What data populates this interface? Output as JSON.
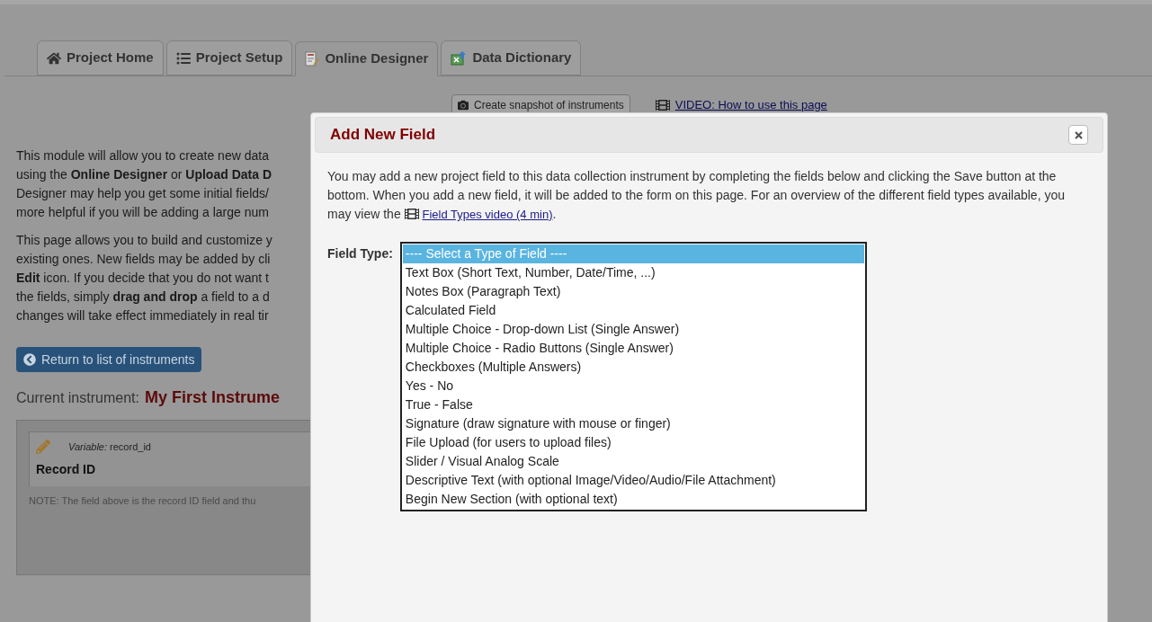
{
  "tabs": [
    {
      "label": "Project Home",
      "selected": false
    },
    {
      "label": "Project Setup",
      "selected": false
    },
    {
      "label": "Online Designer",
      "selected": true
    },
    {
      "label": "Data Dictionary",
      "selected": false
    }
  ],
  "snapshot_button": "Create snapshot of instruments",
  "video_link": "VIDEO: How to use this page",
  "intro_lines": [
    "This module will allow you to create new data",
    "using the **Online Designer** or **Upload Data D**",
    "Designer may help you get some initial fields/",
    "more helpful if you will be adding a large num"
  ],
  "help_lines": [
    "This page allows you to build and customize y",
    "existing ones. New fields may be added by cli",
    "**Edit** icon. If you decide that you do not want t",
    "the fields, simply **drag and drop** a field to a d",
    "changes will take effect immediately in real tir"
  ],
  "return_button": "Return to list of instruments",
  "current_instrument": {
    "label": "Current instrument:",
    "name": "My First Instrume"
  },
  "field_card": {
    "variable_label": "Variable:",
    "variable": "record_id",
    "label": "Record ID",
    "note": "NOTE: The field above is the record ID field and thu"
  },
  "dialog": {
    "title": "Add New Field",
    "intro": "You may add a new project field to this data collection instrument by completing the fields below and clicking the Save button at the bottom. When you add a new field, it will be added to the form on this page. For an overview of the different field types available, you may view the",
    "intro_link": "Field Types video (4 min)",
    "intro_end": ".",
    "field_type_label": "Field Type:",
    "options": [
      {
        "label": "---- Select a Type of Field ----",
        "selected": true
      },
      {
        "label": "Text Box (Short Text, Number, Date/Time, ...)",
        "selected": false
      },
      {
        "label": "Notes Box (Paragraph Text)",
        "selected": false
      },
      {
        "label": "Calculated Field",
        "selected": false
      },
      {
        "label": "Multiple Choice - Drop-down List (Single Answer)",
        "selected": false
      },
      {
        "label": "Multiple Choice - Radio Buttons (Single Answer)",
        "selected": false
      },
      {
        "label": "Checkboxes (Multiple Answers)",
        "selected": false
      },
      {
        "label": "Yes - No",
        "selected": false
      },
      {
        "label": "True - False",
        "selected": false
      },
      {
        "label": "Signature (draw signature with mouse or finger)",
        "selected": false
      },
      {
        "label": "File Upload (for users to upload files)",
        "selected": false
      },
      {
        "label": "Slider / Visual Analog Scale",
        "selected": false
      },
      {
        "label": "Descriptive Text (with optional Image/Video/Audio/File Attachment)",
        "selected": false
      },
      {
        "label": "Begin New Section (with optional text)",
        "selected": false
      }
    ]
  }
}
